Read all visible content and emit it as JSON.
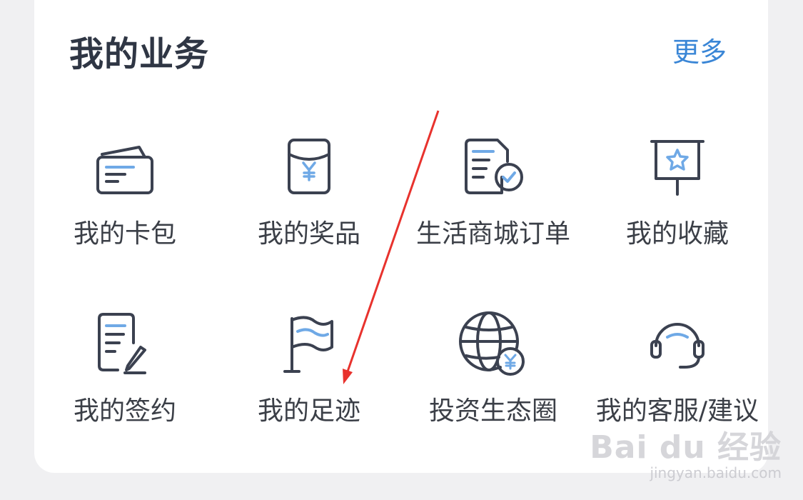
{
  "section": {
    "title": "我的业务",
    "more_label": "更多"
  },
  "grid": {
    "items": [
      {
        "label": "我的卡包",
        "icon": "wallet-icon"
      },
      {
        "label": "我的奖品",
        "icon": "red-packet-icon"
      },
      {
        "label": "生活商城订单",
        "icon": "order-check-icon"
      },
      {
        "label": "我的收藏",
        "icon": "star-board-icon"
      },
      {
        "label": "我的签约",
        "icon": "contract-edit-icon"
      },
      {
        "label": "我的足迹",
        "icon": "flag-icon"
      },
      {
        "label": "投资生态圈",
        "icon": "globe-yuan-icon"
      },
      {
        "label": "我的客服/建议",
        "icon": "headset-icon"
      }
    ]
  },
  "annotation": {
    "arrow_color": "#e8322d"
  },
  "watermark": {
    "logo": "Bai du 经验",
    "url": "jingyan.baidu.com"
  },
  "colors": {
    "icon_stroke": "#3b4150",
    "icon_accent": "#6fa9e6",
    "link": "#3a86d6"
  }
}
